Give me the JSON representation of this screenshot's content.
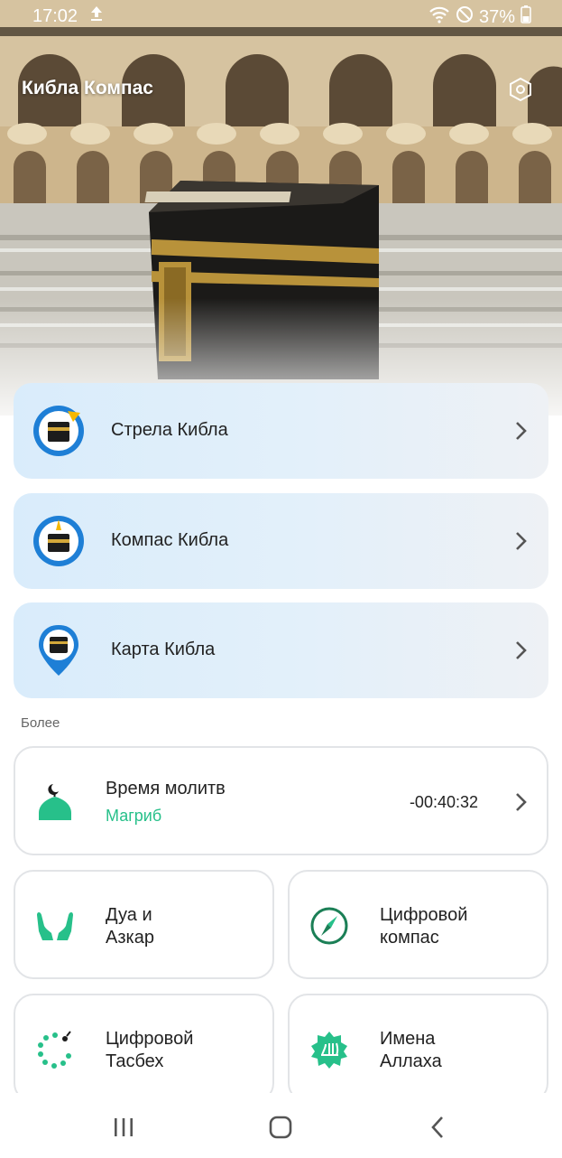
{
  "status_bar": {
    "time": "17:02",
    "battery": "37%"
  },
  "app": {
    "title": "Кибла Компас"
  },
  "qibla_options": [
    {
      "label": "Стрела Кибла",
      "icon": "kaaba-arrow-icon"
    },
    {
      "label": "Компас Кибла",
      "icon": "kaaba-compass-icon"
    },
    {
      "label": "Карта Кибла",
      "icon": "kaaba-map-pin-icon"
    }
  ],
  "more": {
    "section_title": "Более",
    "prayer": {
      "title": "Время молитв",
      "next_prayer": "Магриб",
      "countdown": "-00:40:32",
      "icon": "mosque-crescent-icon"
    },
    "tiles": [
      {
        "line1": "Дуа и",
        "line2": "Азкар",
        "icon": "praying-hands-icon"
      },
      {
        "line1": "Цифровой",
        "line2": "компас",
        "icon": "compass-icon"
      },
      {
        "line1": "Цифровой",
        "line2": "Тасбех",
        "icon": "tasbih-beads-icon"
      },
      {
        "line1": "Имена",
        "line2": "Аллаха",
        "icon": "allah-names-icon"
      }
    ]
  },
  "colors": {
    "accent_green": "#27c08a",
    "icon_blue": "#1e88e5",
    "card_blue": "#dcedfb"
  }
}
